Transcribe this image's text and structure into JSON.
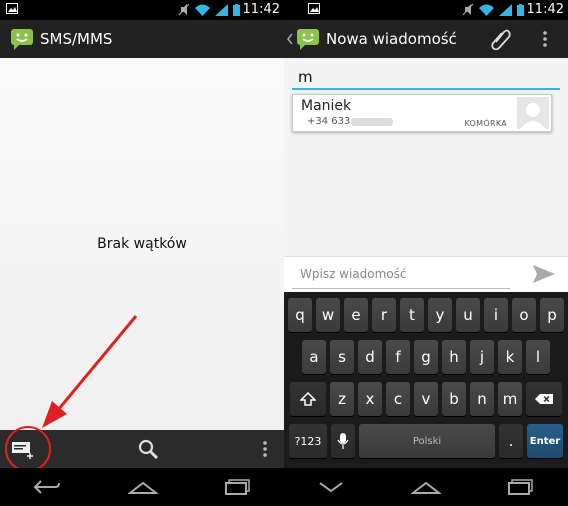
{
  "left": {
    "status": {
      "time": "11:42"
    },
    "title": "SMS/MMS",
    "empty_text": "Brak wątków"
  },
  "right": {
    "status": {
      "time": "11:42"
    },
    "title": "Nowa wiadomość",
    "recipient_value": "m",
    "suggestion": {
      "name": "Maniek",
      "number": "+34 633",
      "type": "KOMÓRKA"
    },
    "compose_placeholder": "Wpisz wiadomość",
    "keyboard": {
      "row1": [
        "q",
        "w",
        "e",
        "r",
        "t",
        "y",
        "u",
        "i",
        "o",
        "p"
      ],
      "row2": [
        "a",
        "s",
        "d",
        "f",
        "g",
        "h",
        "j",
        "k",
        "l"
      ],
      "row3": [
        "z",
        "x",
        "c",
        "v",
        "b",
        "n",
        "m"
      ],
      "num_key": "?123",
      "space_label": "Polski",
      "period": ".",
      "enter": "Enter"
    }
  },
  "colors": {
    "accent": "#33b5e5",
    "sms_green": "#8bc34a",
    "highlight": "#e02020"
  }
}
